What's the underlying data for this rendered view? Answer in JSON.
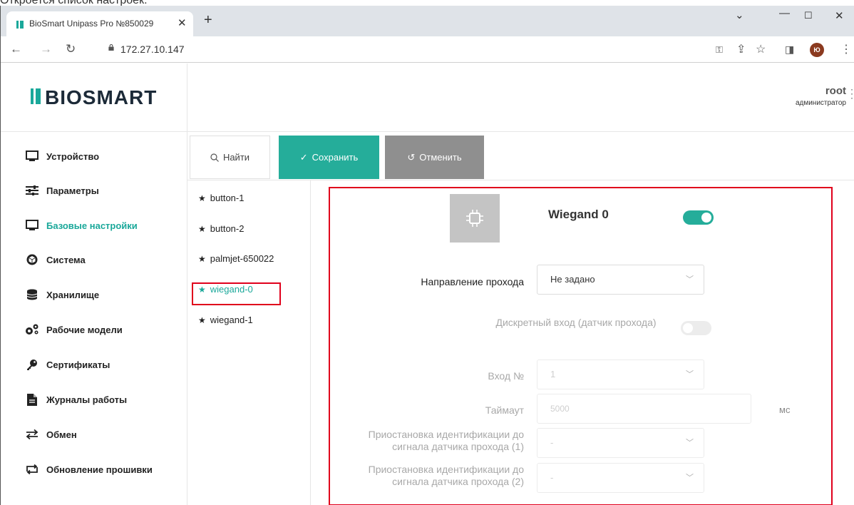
{
  "caption": "Откроется список настроек.",
  "browser": {
    "tab_title": "BioSmart Unipass Pro №850029",
    "url": "172.27.10.147",
    "avatar_initials": "Ю"
  },
  "header": {
    "logo_text": "BIOSMART",
    "user_name": "root",
    "user_role": "администратор"
  },
  "sidebar": {
    "items": [
      {
        "label": "Устройство",
        "icon": "monitor-icon"
      },
      {
        "label": "Параметры",
        "icon": "sliders-icon"
      },
      {
        "label": "Базовые настройки",
        "icon": "monitor-icon",
        "active": true
      },
      {
        "label": "Система",
        "icon": "cube-icon"
      },
      {
        "label": "Хранилище",
        "icon": "database-icon"
      },
      {
        "label": "Рабочие модели",
        "icon": "gears-icon"
      },
      {
        "label": "Сертификаты",
        "icon": "key-icon"
      },
      {
        "label": "Журналы работы",
        "icon": "document-icon"
      },
      {
        "label": "Обмен",
        "icon": "exchange-icon"
      },
      {
        "label": "Обновление прошивки",
        "icon": "refresh-icon"
      }
    ]
  },
  "toolbar": {
    "find_label": "Найти",
    "save_label": "Сохранить",
    "cancel_label": "Отменить"
  },
  "devices": {
    "items": [
      "button-1",
      "button-2",
      "palmjet-650022",
      "wiegand-0",
      "wiegand-1"
    ],
    "selected": "wiegand-0"
  },
  "panel": {
    "title": "Wiegand 0",
    "enabled": true,
    "direction_label": "Направление прохода",
    "direction_value": "Не задано",
    "discrete_label": "Дискретный вход (датчик прохода)",
    "discrete_enabled": false,
    "input_no_label": "Вход №",
    "input_no_value": "1",
    "timeout_label": "Таймаут",
    "timeout_value": "5000",
    "timeout_unit": "мс",
    "suspend1_label": "Приостановка идентификации до сигнала датчика прохода (1)",
    "suspend1_value": "-",
    "suspend2_label": "Приостановка идентификации до сигнала датчика прохода (2)",
    "suspend2_value": "-"
  },
  "colors": {
    "accent": "#25ad9a",
    "highlight": "#e0001c",
    "cancel": "#8f8f8f"
  }
}
